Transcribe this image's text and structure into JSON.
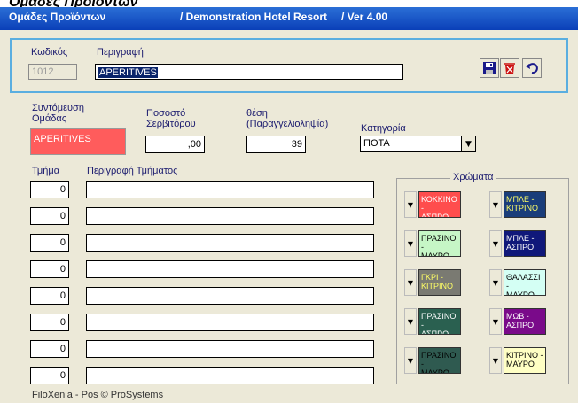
{
  "outer_title": "Ομάδες Προϊόντων",
  "titlebar": {
    "left": "Ομάδες Προϊόντων",
    "middle": "/ Demonstration Hotel Resort",
    "right": "/ Ver  4.00"
  },
  "header": {
    "code_label": "Κωδικός",
    "code_value": "1012",
    "description_label": "Περιγραφή",
    "description_value": "APERITIVES",
    "save_icon": "save-disk-icon",
    "delete_icon": "trash-bin-icon",
    "undo_icon": "undo-arrow-icon"
  },
  "group": {
    "abbrev_label": "Συντόμευση\nΟμάδας",
    "abbrev_value": "APERITIVES",
    "waiter_pct_label": "Ποσοστό\nΣερβιτόρου",
    "waiter_pct_value": ",00",
    "position_label": "θέση\n(Παραγγελιοληψία)",
    "position_value": "39",
    "category_label": "Κατηγορία",
    "category_value": "ΠΟΤΑ"
  },
  "departments": {
    "col_dept": "Τμήμα",
    "col_desc": "Περιγραφή Τμήματος",
    "rows": [
      {
        "dept": "0",
        "desc": ""
      },
      {
        "dept": "0",
        "desc": ""
      },
      {
        "dept": "0",
        "desc": ""
      },
      {
        "dept": "0",
        "desc": ""
      },
      {
        "dept": "0",
        "desc": ""
      },
      {
        "dept": "0",
        "desc": ""
      },
      {
        "dept": "0",
        "desc": ""
      },
      {
        "dept": "0",
        "desc": ""
      }
    ]
  },
  "colors": {
    "title": "Χρώματα",
    "swatches": [
      {
        "label": "ΚΟΚΚΙΝΟ -\nΑΣΠΡΟ",
        "bg": "#ff4d4d",
        "fg": "#ffffff"
      },
      {
        "label": "ΜΠΛΕ -\nΚΙΤΡΙΝΟ",
        "bg": "#1a3d7a",
        "fg": "#ffff66"
      },
      {
        "label": "ΠΡΑΣΙΝΟ -\nΜΑΥΡΟ",
        "bg": "#c6f6c6",
        "fg": "#000000"
      },
      {
        "label": "ΜΠΛΕ -\nΑΣΠΡΟ",
        "bg": "#10187a",
        "fg": "#ffffff"
      },
      {
        "label": "ΓΚΡΙ -\nΚΙΤΡΙΝΟ",
        "bg": "#7a7a72",
        "fg": "#ffff66"
      },
      {
        "label": "ΘΑΛΑΣΣΙ -\nΜΑΥΡΟ",
        "bg": "#d4fff4",
        "fg": "#000000"
      },
      {
        "label": "ΠΡΑΣΙΝΟ -\nΑΣΠΡΟ",
        "bg": "#2a6050",
        "fg": "#ffffff"
      },
      {
        "label": "ΜΩΒ -\nΑΣΠΡΟ",
        "bg": "#7a0a8a",
        "fg": "#ffffff"
      },
      {
        "label": "ΠΡΑΣΙΝΟ -\nΜΑΥΡΟ",
        "bg": "#2f5a50",
        "fg": "#000000"
      },
      {
        "label": "ΚΙΤΡΙΝΟ -\nΜΑΥΡΟ",
        "bg": "#ffffc4",
        "fg": "#000000"
      }
    ]
  },
  "footer": "FiloXenia - Pos  © ProSystems"
}
